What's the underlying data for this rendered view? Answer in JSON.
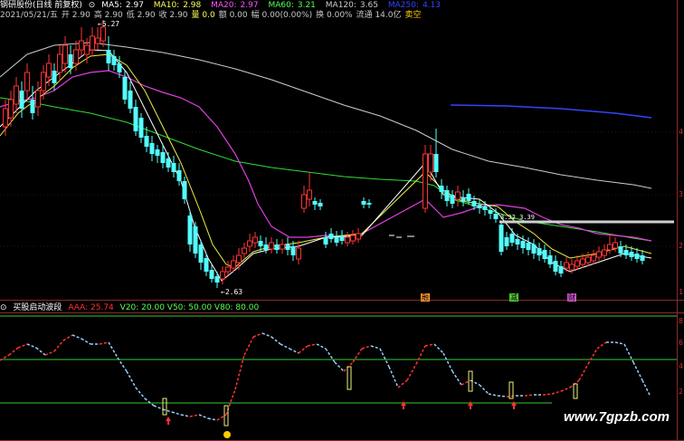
{
  "header": {
    "title": "钢研股份(日线 前复权)",
    "ma": [
      {
        "label": "MA5:",
        "value": "2.97",
        "color": "#ffffff"
      },
      {
        "label": "MA10:",
        "value": "2.98",
        "color": "#ffff55"
      },
      {
        "label": "MA20:",
        "value": "2.97",
        "color": "#ff55ff"
      },
      {
        "label": "MA60:",
        "value": "3.21",
        "color": "#55ff55"
      },
      {
        "label": "MA120:",
        "value": "3.65",
        "color": "#cccccc"
      },
      {
        "label": "MA250:",
        "value": "4.13",
        "color": "#3344ff"
      }
    ]
  },
  "info": {
    "date": "2021/05/21/五",
    "open": "开 2.90",
    "high": "高 2.90",
    "low": "低 2.90",
    "close": "收 2.90",
    "vol": "量 0.0",
    "amount": "额 0.00",
    "change": "幅 0.00(0.00%)",
    "turnover": "换 0.00%",
    "float": "流通 14.0亿",
    "signal": "卖空"
  },
  "annotations": {
    "high_price": "5.27",
    "low_price": "2.63",
    "range_label": "3.32 3.39",
    "badge1": "融",
    "badge2": "减",
    "badge3": "财"
  },
  "indicator": {
    "title": "买股启动波段",
    "aaa": "AAA: 25.74",
    "lines": "V20: 20.00  V50: 50.00  V80: 80.00"
  },
  "axis": {
    "ticks": [
      "4",
      "3",
      "2",
      "1",
      "8",
      "6",
      "4",
      "2"
    ]
  },
  "watermark": "www.7gpzb.com",
  "colors": {
    "up": "#ff3232",
    "down": "#54ffff",
    "grid": "#b0303a"
  }
}
